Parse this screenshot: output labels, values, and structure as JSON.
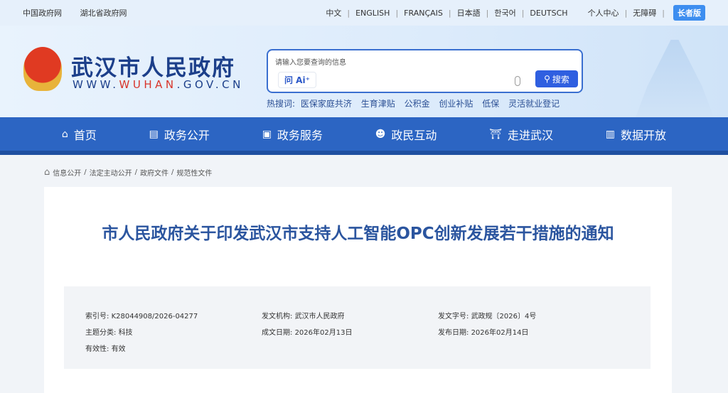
{
  "topbar": {
    "links": [
      "中国政府网",
      "湖北省政府网"
    ],
    "languages": [
      "中文",
      "ENGLISH",
      "FRANÇAIS",
      "日本語",
      "한국어",
      "DEUTSCH"
    ],
    "user_center": "个人中心",
    "accessibility": "无障碍",
    "elder": "长者版"
  },
  "header": {
    "title": "武汉市人民政府",
    "url_pre": "WWW.",
    "url_mid": "WUHAN",
    "url_post": ".GOV.CN",
    "search_placeholder": "请输入您要查询的信息",
    "ai_label": "问 Ai⁺",
    "search_button": "搜索",
    "hot_label": "热搜词:",
    "hot_words": [
      "医保家庭共济",
      "生育津贴",
      "公积金",
      "创业补贴",
      "低保",
      "灵活就业登记"
    ]
  },
  "nav": [
    {
      "label": "首页",
      "icon": "⌂"
    },
    {
      "label": "政务公开",
      "icon": "▤"
    },
    {
      "label": "政务服务",
      "icon": "▣"
    },
    {
      "label": "政民互动",
      "icon": "☻"
    },
    {
      "label": "走进武汉",
      "icon": "⛩"
    },
    {
      "label": "数据开放",
      "icon": "▥"
    }
  ],
  "breadcrumb": [
    "信息公开",
    "法定主动公开",
    "政府文件",
    "规范性文件"
  ],
  "article": {
    "title": "市人民政府关于印发武汉市支持人工智能OPC创新发展若干措施的通知",
    "meta": [
      {
        "k": "索引号:",
        "v": "K28044908/2026-04277"
      },
      {
        "k": "发文机构:",
        "v": "武汉市人民政府"
      },
      {
        "k": "发文字号:",
        "v": "武政规〔2026〕4号"
      },
      {
        "k": "主题分类:",
        "v": "科技"
      },
      {
        "k": "成文日期:",
        "v": "2026年02月13日"
      },
      {
        "k": "发布日期:",
        "v": "2026年02月14日"
      },
      {
        "k": "有效性:",
        "v": "有效"
      }
    ]
  }
}
